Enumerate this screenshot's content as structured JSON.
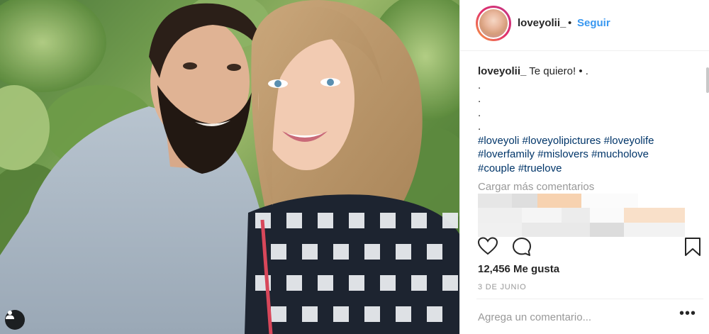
{
  "post": {
    "photo": {
      "tag_icon": "person-tag-icon"
    },
    "header": {
      "username": "loveyolii_",
      "separator": "•",
      "follow_label": "Seguir"
    },
    "caption": {
      "username": "loveyolii_",
      "text": "Te quiero! • .",
      "dots": [
        ".",
        ".",
        ".",
        "."
      ],
      "hashtag_lines": [
        [
          "#loveyoli",
          "#loveyolipictures",
          "#loveyolife"
        ],
        [
          "#loverfamily",
          "#mislovers",
          "#mucholove"
        ],
        [
          "#couple",
          "#truelove"
        ]
      ]
    },
    "load_more": "Cargar más comentarios",
    "actions": {
      "like_icon": "heart-icon",
      "comment_icon": "comment-icon",
      "save_icon": "bookmark-icon"
    },
    "likes": "12,456 Me gusta",
    "date": "3 DE JUNIO",
    "comment_box": {
      "placeholder": "Agrega un comentario...",
      "more_label": "•••"
    },
    "colors": {
      "link_blue": "#3897f0",
      "hashtag": "#003569",
      "muted": "#999999",
      "text": "#262626"
    }
  }
}
